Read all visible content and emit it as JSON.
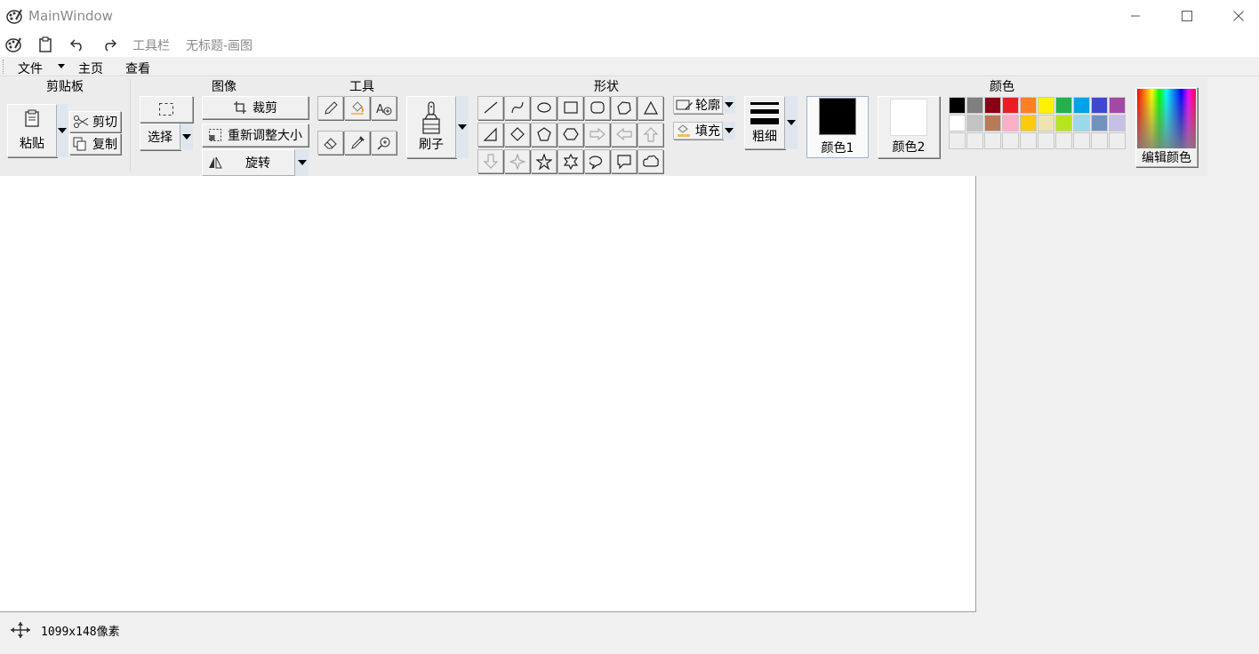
{
  "window": {
    "title": "MainWindow",
    "controls": [
      "minimize",
      "maximize",
      "close"
    ]
  },
  "quick_toolbar": {
    "toolbar_label": "工具栏",
    "document_title": "无标题-画图"
  },
  "menu": {
    "items": [
      "文件",
      "主页",
      "查看"
    ]
  },
  "ribbon": {
    "clipboard": {
      "title": "剪贴板",
      "paste": "粘贴",
      "cut": "剪切",
      "copy": "复制"
    },
    "image": {
      "title": "图像",
      "select": "选择",
      "crop": "裁剪",
      "resize": "重新调整大小",
      "rotate": "旋转"
    },
    "tools": {
      "title": "工具",
      "brush": "刷子"
    },
    "shapes": {
      "title": "形状",
      "outline": "轮廓",
      "fill": "填充"
    },
    "size": {
      "label": "粗细"
    },
    "colors": {
      "title": "颜色",
      "color1": "颜色1",
      "color2": "颜色2",
      "edit": "编辑颜色",
      "color1_value": "#000000",
      "color2_value": "#ffffff",
      "palette_row1": [
        "#000000",
        "#7f7f7f",
        "#880015",
        "#ed1c24",
        "#ff7f27",
        "#fff200",
        "#22b14c",
        "#00a2e8",
        "#3f48cc",
        "#a349a4"
      ],
      "palette_row2": [
        "#ffffff",
        "#c3c3c3",
        "#b97a57",
        "#ffaec9",
        "#ffc90e",
        "#efe4b0",
        "#b5e61d",
        "#99d9ea",
        "#7092be",
        "#c8bfe7"
      ],
      "palette_row3": [
        "#eeeeee",
        "#eeeeee",
        "#eeeeee",
        "#eeeeee",
        "#eeeeee",
        "#eeeeee",
        "#eeeeee",
        "#eeeeee",
        "#eeeeee",
        "#eeeeee"
      ]
    }
  },
  "status": {
    "canvas_size": "1099x148像素"
  }
}
